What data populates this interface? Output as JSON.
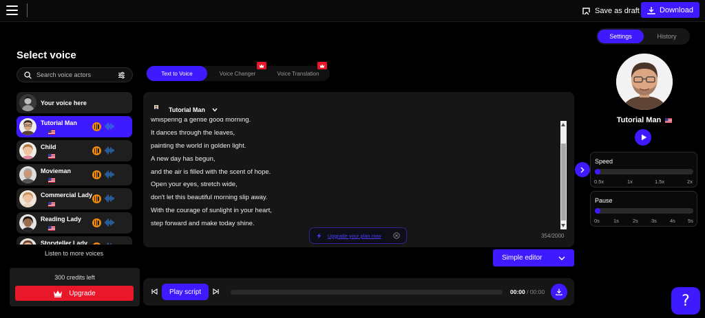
{
  "topbar": {
    "save_draft_label": "Save as draft",
    "download_label": "Download"
  },
  "left": {
    "title": "Select voice",
    "search_placeholder": "Search voice actors",
    "voices": [
      {
        "name": "Your voice here",
        "flag": false,
        "active": false
      },
      {
        "name": "Tutorial Man",
        "flag": true,
        "active": true
      },
      {
        "name": "Child",
        "flag": true,
        "active": false
      },
      {
        "name": "Movieman",
        "flag": true,
        "active": false
      },
      {
        "name": "Commercial Lady",
        "flag": true,
        "active": false
      },
      {
        "name": "Reading Lady",
        "flag": true,
        "active": false
      },
      {
        "name": "Storyteller Lady",
        "flag": true,
        "active": false
      }
    ],
    "more_voices_label": "Listen to more voices",
    "credits_text": "300 credits left",
    "upgrade_label": "Upgrade"
  },
  "tabs": [
    {
      "label": "Text to Voice",
      "active": true,
      "premium": false
    },
    {
      "label": "Voice Changer",
      "active": false,
      "premium": true
    },
    {
      "label": "Voice Translation",
      "active": false,
      "premium": true
    }
  ],
  "editor": {
    "speaker": "Tutorial Man",
    "script_lines": [
      "whispering a gentle good morning.",
      "It dances through the leaves,",
      "painting the world in golden light.",
      "A new day has begun,",
      "and the air is filled with the scent of hope.",
      "Open your eyes, stretch wide,",
      "don't let this beautiful morning slip away.",
      "With the courage of sunlight in your heart,",
      "step forward and make today shine."
    ],
    "upgrade_plan_link": "Upgrade your plan now",
    "char_count": "354/2000",
    "simple_editor_label": "Simple editor"
  },
  "player": {
    "play_script_label": "Play script",
    "current_time": "00:00",
    "total_time": " / 00:00"
  },
  "right": {
    "tabs": [
      "Settings",
      "History"
    ],
    "voice_name": "Tutorial Man",
    "speed": {
      "title": "Speed",
      "ticks": [
        "0.5x",
        "1x",
        "1.5x",
        "2x"
      ],
      "value": "0.5x"
    },
    "pause": {
      "title": "Pause",
      "ticks": [
        "0s",
        "1s",
        "2s",
        "3s",
        "4s",
        "5s"
      ],
      "value": "0s"
    }
  },
  "help_label": "?",
  "colors": {
    "accent": "#3d1aff",
    "danger": "#e8172a",
    "wave_orange": "#f08a0a"
  }
}
